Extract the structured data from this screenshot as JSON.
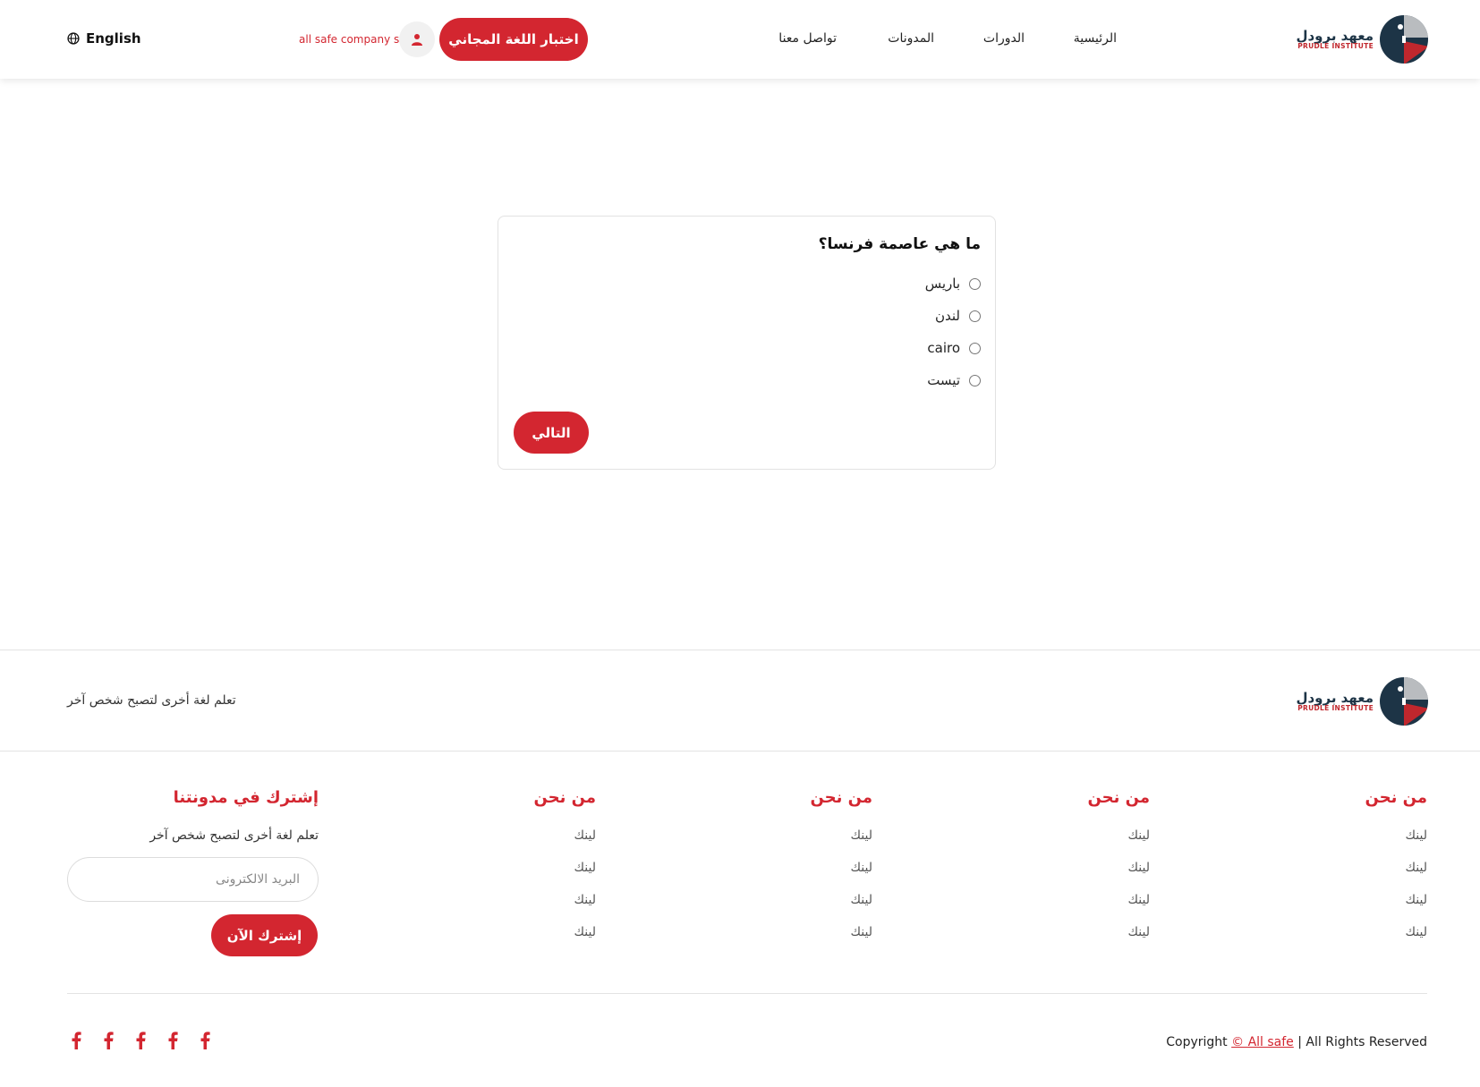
{
  "header": {
    "brand_ar": "معهد برودل",
    "brand_en": "PRUDLE INSTITUTE",
    "nav": {
      "home": "الرئيسية",
      "courses": "الدورات",
      "blogs": "المدونات",
      "contact": "تواصل معنا"
    },
    "test_button": "اختبار اللغة المجاني",
    "user_name": "all safe company s",
    "language": "English"
  },
  "quiz": {
    "question": "ما هي عاصمة فرنسا؟",
    "options": [
      "باريس",
      "لندن",
      "cairo",
      "تيست"
    ],
    "next_button": "التالي"
  },
  "footer": {
    "brand_ar": "معهد برودل",
    "brand_en": "PRUDLE INSTITUTE",
    "tagline": "تعلم لغة أخرى لتصبح شخص آخر",
    "columns": [
      {
        "title": "من نحن",
        "links": [
          "لينك",
          "لينك",
          "لينك",
          "لينك"
        ]
      },
      {
        "title": "من نحن",
        "links": [
          "لينك",
          "لينك",
          "لينك",
          "لينك"
        ]
      },
      {
        "title": "من نحن",
        "links": [
          "لينك",
          "لينك",
          "لينك",
          "لينك"
        ]
      },
      {
        "title": "من نحن",
        "links": [
          "لينك",
          "لينك",
          "لينك",
          "لينك"
        ]
      }
    ],
    "subscribe": {
      "title": "إشترك في مدونتنا",
      "text": "تعلم لغة أخرى لتصبح شخص آخر",
      "placeholder": "البريد الالكترونى",
      "button": "إشترك الآن"
    },
    "copyright": {
      "prefix": "Copyright",
      "link": "© All safe",
      "suffix": "| All Rights Reserved"
    }
  },
  "colors": {
    "accent": "#d32630",
    "brand_dark": "#1d3446"
  }
}
